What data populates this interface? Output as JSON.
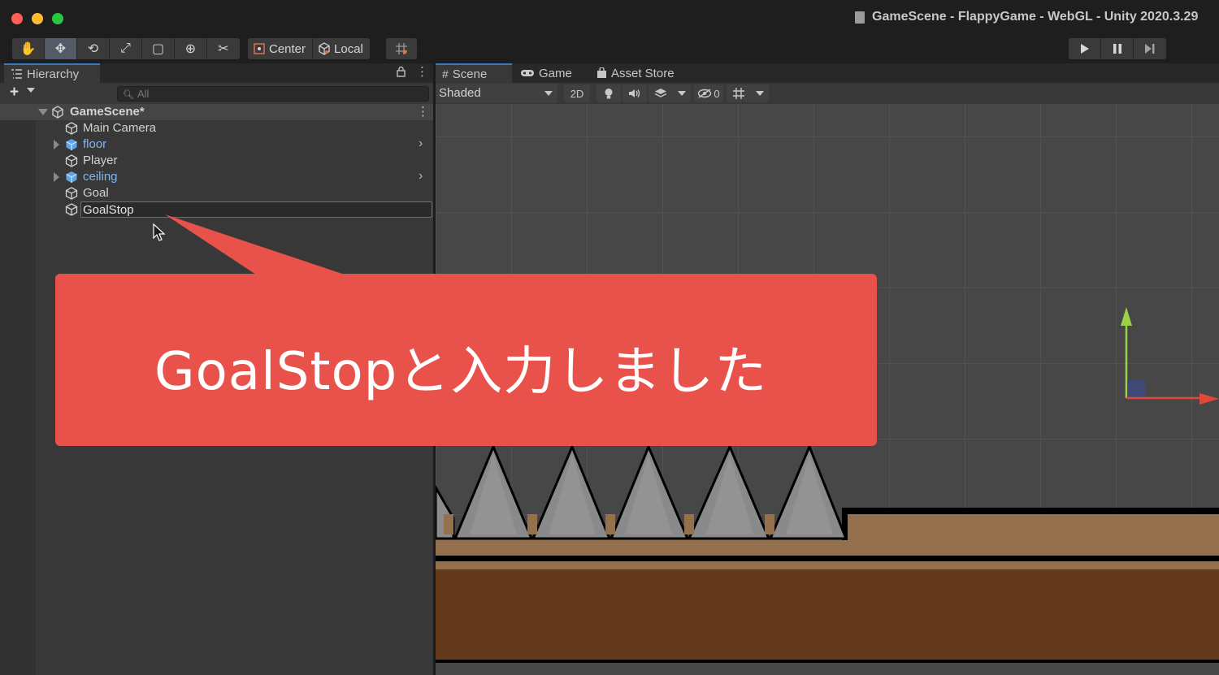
{
  "window": {
    "title": "GameScene - FlappyGame - WebGL - Unity 2020.3.29"
  },
  "toolbar": {
    "tools": [
      {
        "name": "hand-tool",
        "glyph": "✋"
      },
      {
        "name": "move-tool",
        "glyph": "✥"
      },
      {
        "name": "rotate-tool",
        "glyph": "⟲"
      },
      {
        "name": "scale-tool",
        "glyph": "⤢"
      },
      {
        "name": "rect-tool",
        "glyph": "▢"
      },
      {
        "name": "transform-tool",
        "glyph": "⊕"
      },
      {
        "name": "custom-tool",
        "glyph": "✂"
      }
    ],
    "pivot_mode": "Center",
    "pivot_rotation": "Local"
  },
  "hierarchy": {
    "tab_label": "Hierarchy",
    "search_placeholder": "All",
    "scene_name": "GameScene*",
    "items": [
      {
        "label": "Main Camera",
        "prefab": false,
        "expandable": false
      },
      {
        "label": "floor",
        "prefab": true,
        "expandable": true
      },
      {
        "label": "Player",
        "prefab": false,
        "expandable": false
      },
      {
        "label": "ceiling",
        "prefab": true,
        "expandable": true
      },
      {
        "label": "Goal",
        "prefab": false,
        "expandable": false
      }
    ],
    "rename_value": "GoalStop"
  },
  "scene_view": {
    "tabs": [
      "Scene",
      "Game",
      "Asset Store"
    ],
    "shading_mode": "Shaded",
    "toggle_2d": "2D",
    "hidden_count": "0"
  },
  "callout": {
    "text": "GoalStopと入力しました"
  },
  "colors": {
    "accent": "#3a79bb",
    "prefab_text": "#7fb6f5",
    "callout": "#e9514b",
    "gizmo_x": "#e0483a",
    "gizmo_y": "#9ad24a",
    "ground_light": "#94704e",
    "ground_dark": "#633a1b"
  }
}
